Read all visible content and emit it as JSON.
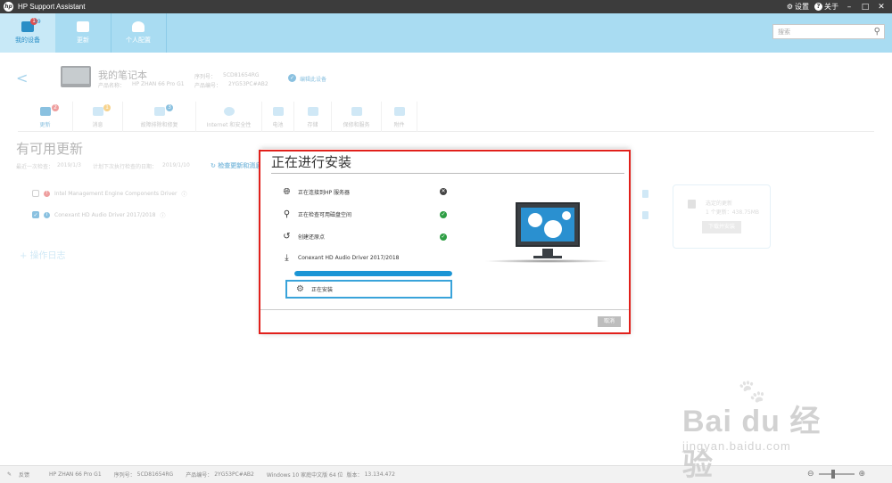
{
  "app": {
    "title": "HP Support Assistant"
  },
  "titlebar": {
    "settings_label": "设置",
    "about_label": "关于",
    "minimize": "–",
    "maximize": "□",
    "close": "✕"
  },
  "nav": {
    "items": [
      {
        "label": "我的设备",
        "badge": "1",
        "count": "19"
      },
      {
        "label": "更新"
      },
      {
        "label": "个人配置"
      }
    ],
    "search_placeholder": "搜索"
  },
  "device": {
    "name": "我的笔记本",
    "product_name_label": "产品名称：",
    "product_name": "HP ZHAN 66 Pro G1",
    "serial_label": "序列号：",
    "serial": "5CD81654RG",
    "product_no_label": "产品编号：",
    "product_no": "2YG53PC#AB2",
    "edit_link": "编辑此设备"
  },
  "tabs": [
    {
      "label": "更新",
      "badge": "2"
    },
    {
      "label": "消息",
      "badge": "1"
    },
    {
      "label": "故障排除和修复",
      "badge": "3"
    },
    {
      "label": "Internet 和安全性"
    },
    {
      "label": "电池"
    },
    {
      "label": "存储"
    },
    {
      "label": "保修和服务"
    },
    {
      "label": "附件"
    }
  ],
  "updates": {
    "title": "有可用更新",
    "last_check_label": "最近一次检查：",
    "last_check": "2019/1/3",
    "next_check_label": "计划下次执行检查的日期：",
    "next_check": "2019/1/10",
    "check_link": "检查更新和消息",
    "rows": [
      {
        "name": "Intel Management Engine Components Driver",
        "checked": false
      },
      {
        "name": "Conexant HD Audio Driver 2017/2018",
        "checked": true
      }
    ],
    "log_label": "操作日志",
    "selected_title": "选定的更新",
    "selected_summary": "1 个更新：438.75MB",
    "download_button": "下载并安装"
  },
  "dialog": {
    "title": "正在进行安装",
    "steps": [
      {
        "label": "正在连接到HP 服务器",
        "icon": "globe-icon",
        "status": "failed"
      },
      {
        "label": "正在检查可用磁盘空间",
        "icon": "magnifier-icon",
        "status": "done"
      },
      {
        "label": "创建还原点",
        "icon": "restore-icon",
        "status": "done"
      },
      {
        "label": "Conexant HD Audio Driver 2017/2018",
        "icon": "download-icon",
        "status": "active"
      }
    ],
    "progress": 1.0,
    "installing_label": "正在安装",
    "cancel_label": "取消",
    "accent": "#1a95d5",
    "ok_color": "#2e9e44",
    "fail_color": "#444444",
    "highlight_color": "#e1201b"
  },
  "statusbar": {
    "feedback_label": "反馈",
    "model": "HP ZHAN 66 Pro G1",
    "serial_label": "序列号：",
    "serial": "5CD81654RG",
    "product_no_label": "产品编号：",
    "product_no": "2YG53PC#AB2",
    "os": "Windows 10 家庭中文版 64 位",
    "version_label": "版本：",
    "version": "13.134.472"
  },
  "watermark": {
    "brand": "Bai du 经验",
    "url": "jingyan.baidu.com"
  }
}
